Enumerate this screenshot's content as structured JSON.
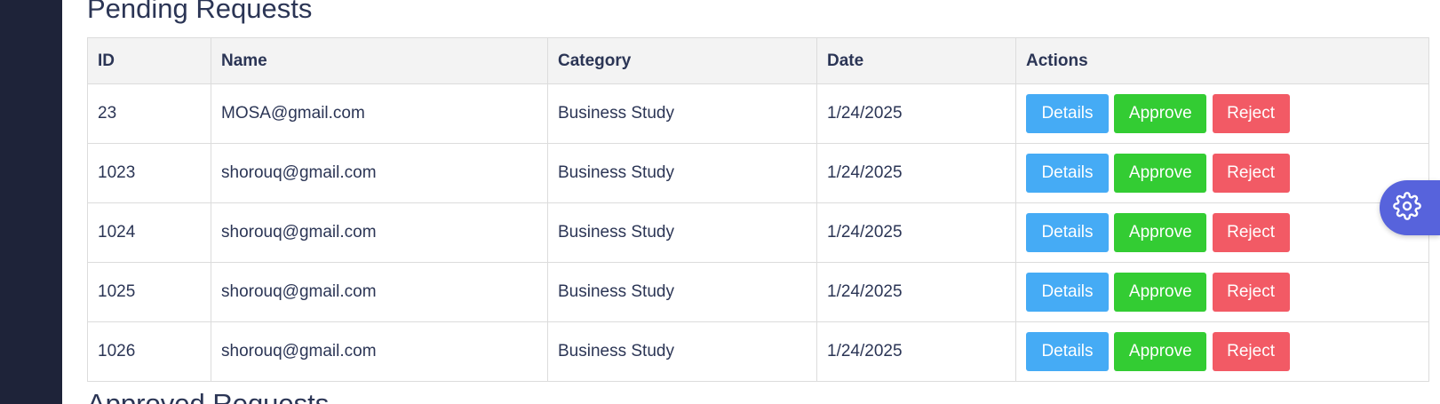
{
  "pending": {
    "title": "Pending Requests",
    "columns": {
      "id": "ID",
      "name": "Name",
      "category": "Category",
      "date": "Date",
      "actions": "Actions"
    },
    "rows": [
      {
        "id": "23",
        "name": "MOSA@gmail.com",
        "category": "Business Study",
        "date": "1/24/2025"
      },
      {
        "id": "1023",
        "name": "shorouq@gmail.com",
        "category": "Business Study",
        "date": "1/24/2025"
      },
      {
        "id": "1024",
        "name": "shorouq@gmail.com",
        "category": "Business Study",
        "date": "1/24/2025"
      },
      {
        "id": "1025",
        "name": "shorouq@gmail.com",
        "category": "Business Study",
        "date": "1/24/2025"
      },
      {
        "id": "1026",
        "name": "shorouq@gmail.com",
        "category": "Business Study",
        "date": "1/24/2025"
      }
    ],
    "actions": {
      "details_label": "Details",
      "approve_label": "Approve",
      "reject_label": "Reject"
    }
  },
  "approved": {
    "title": "Approved Requests"
  },
  "settings": {
    "icon": "gear-icon"
  },
  "colors": {
    "sidebar": "#1e2339",
    "text": "#2b3555",
    "details": "#45abf5",
    "approve": "#33cc33",
    "reject": "#f25a65",
    "settings": "#5763dc"
  }
}
